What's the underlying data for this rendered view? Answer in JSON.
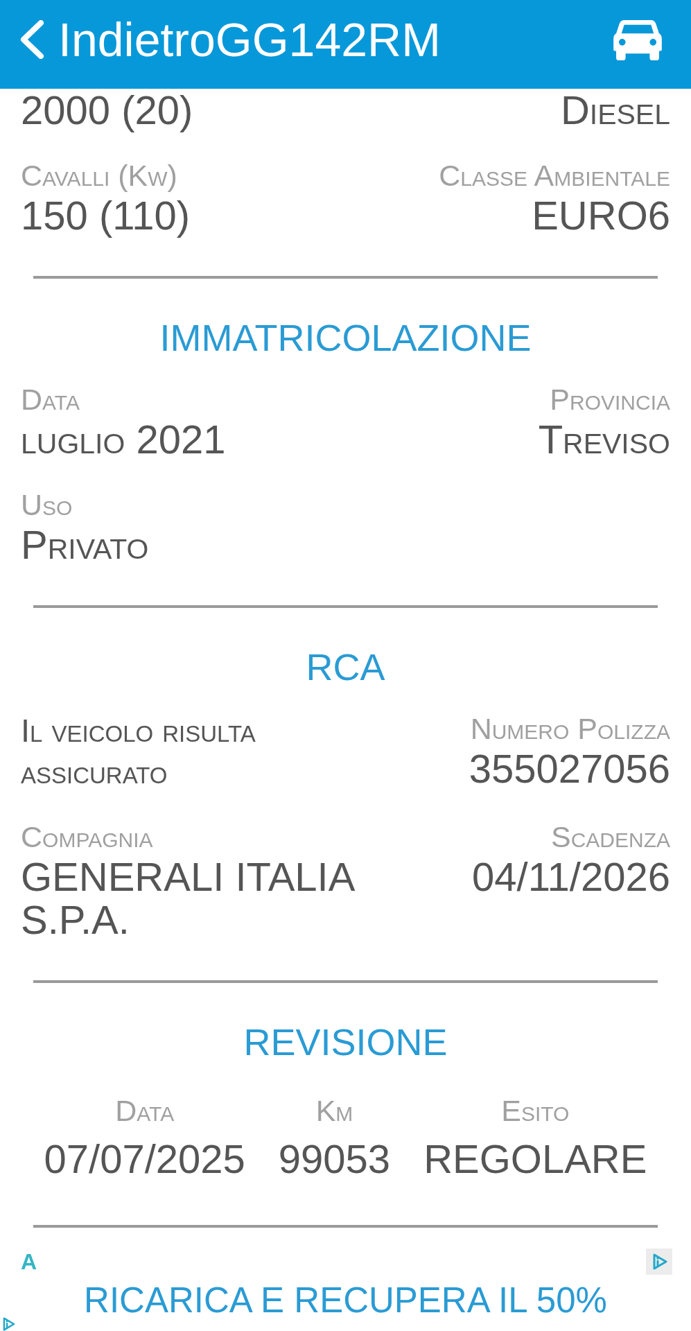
{
  "header": {
    "back_label": "Indietro",
    "title": "GG142RM"
  },
  "sections": [
    {
      "kind": "fields",
      "rows": [
        [
          {
            "kind": "field",
            "value": "2000 (20)"
          },
          {
            "kind": "field",
            "value": "Diesel"
          }
        ],
        [
          {
            "kind": "field",
            "label": "Cavalli (Kw)",
            "value": "150 (110)"
          },
          {
            "kind": "field",
            "label": "Classe Ambientale",
            "value": "EURO6"
          }
        ]
      ]
    },
    {
      "kind": "fields",
      "title": "IMMATRICOLAZIONE",
      "rows": [
        [
          {
            "kind": "field",
            "label": "Data",
            "value": "luglio 2021"
          },
          {
            "kind": "field",
            "label": "Provincia",
            "value": "Treviso"
          }
        ],
        [
          {
            "kind": "field",
            "label": "Uso",
            "value": "Privato"
          }
        ]
      ]
    },
    {
      "kind": "fields",
      "title": "RCA",
      "rows": [
        [
          {
            "kind": "status",
            "value": "Il veicolo risulta assicurato"
          },
          {
            "kind": "field",
            "label": "Numero Polizza",
            "value": "355027056"
          }
        ],
        [
          {
            "kind": "field",
            "label": "Compagnia",
            "value": "GENERALI ITALIA S.P.A."
          },
          {
            "kind": "field",
            "label": "Scadenza",
            "value": "04/11/2026"
          }
        ]
      ]
    },
    {
      "kind": "columns",
      "title": "REVISIONE",
      "columns": [
        {
          "label": "Data",
          "value": "07/07/2025"
        },
        {
          "label": "Km",
          "value": "99053"
        },
        {
          "label": "Esito",
          "value": "REGOLARE"
        }
      ]
    }
  ],
  "ad": {
    "badge": "A",
    "headline": "RICARICA E RECUPERA IL 50%"
  }
}
